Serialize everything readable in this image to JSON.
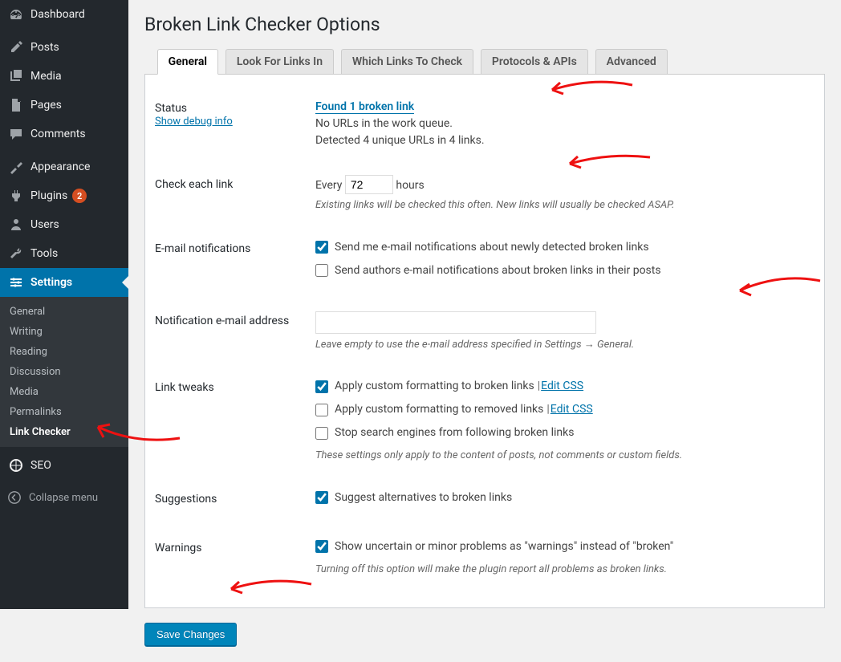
{
  "sidebar": {
    "items": [
      {
        "label": "Dashboard",
        "icon": "dashboard"
      },
      {
        "label": "Posts",
        "icon": "posts"
      },
      {
        "label": "Media",
        "icon": "media"
      },
      {
        "label": "Pages",
        "icon": "pages"
      },
      {
        "label": "Comments",
        "icon": "comments"
      },
      {
        "label": "Appearance",
        "icon": "appearance"
      },
      {
        "label": "Plugins",
        "icon": "plugins",
        "badge": "2"
      },
      {
        "label": "Users",
        "icon": "users"
      },
      {
        "label": "Tools",
        "icon": "tools"
      },
      {
        "label": "Settings",
        "icon": "settings"
      }
    ],
    "settings_submenu": [
      "General",
      "Writing",
      "Reading",
      "Discussion",
      "Media",
      "Permalinks",
      "Link Checker"
    ],
    "seo_label": "SEO",
    "collapse_label": "Collapse menu"
  },
  "page": {
    "title": "Broken Link Checker Options",
    "tabs": [
      "General",
      "Look For Links In",
      "Which Links To Check",
      "Protocols & APIs",
      "Advanced"
    ]
  },
  "status": {
    "label": "Status",
    "debug_link": "Show debug info",
    "found_link": "Found 1 broken link",
    "queue_text": "No URLs in the work queue.",
    "detected_text": "Detected 4 unique URLs in 4 links."
  },
  "check_each": {
    "label": "Check each link",
    "prefix": "Every",
    "value": "72",
    "suffix": "hours",
    "desc": "Existing links will be checked this often. New links will usually be checked ASAP."
  },
  "email_notif": {
    "label": "E-mail notifications",
    "opt1": "Send me e-mail notifications about newly detected broken links",
    "opt2": "Send authors e-mail notifications about broken links in their posts"
  },
  "notif_email": {
    "label": "Notification e-mail address",
    "value": "",
    "desc": "Leave empty to use the e-mail address specified in Settings → General."
  },
  "tweaks": {
    "label": "Link tweaks",
    "opt1": "Apply custom formatting to broken links",
    "opt2": "Apply custom formatting to removed links",
    "opt3": "Stop search engines from following broken links",
    "edit_css": "Edit CSS",
    "desc": "These settings only apply to the content of posts, not comments or custom fields."
  },
  "suggestions": {
    "label": "Suggestions",
    "opt1": "Suggest alternatives to broken links"
  },
  "warnings": {
    "label": "Warnings",
    "opt1": "Show uncertain or minor problems as \"warnings\" instead of \"broken\"",
    "desc": "Turning off this option will make the plugin report all problems as broken links."
  },
  "save_button": "Save Changes"
}
